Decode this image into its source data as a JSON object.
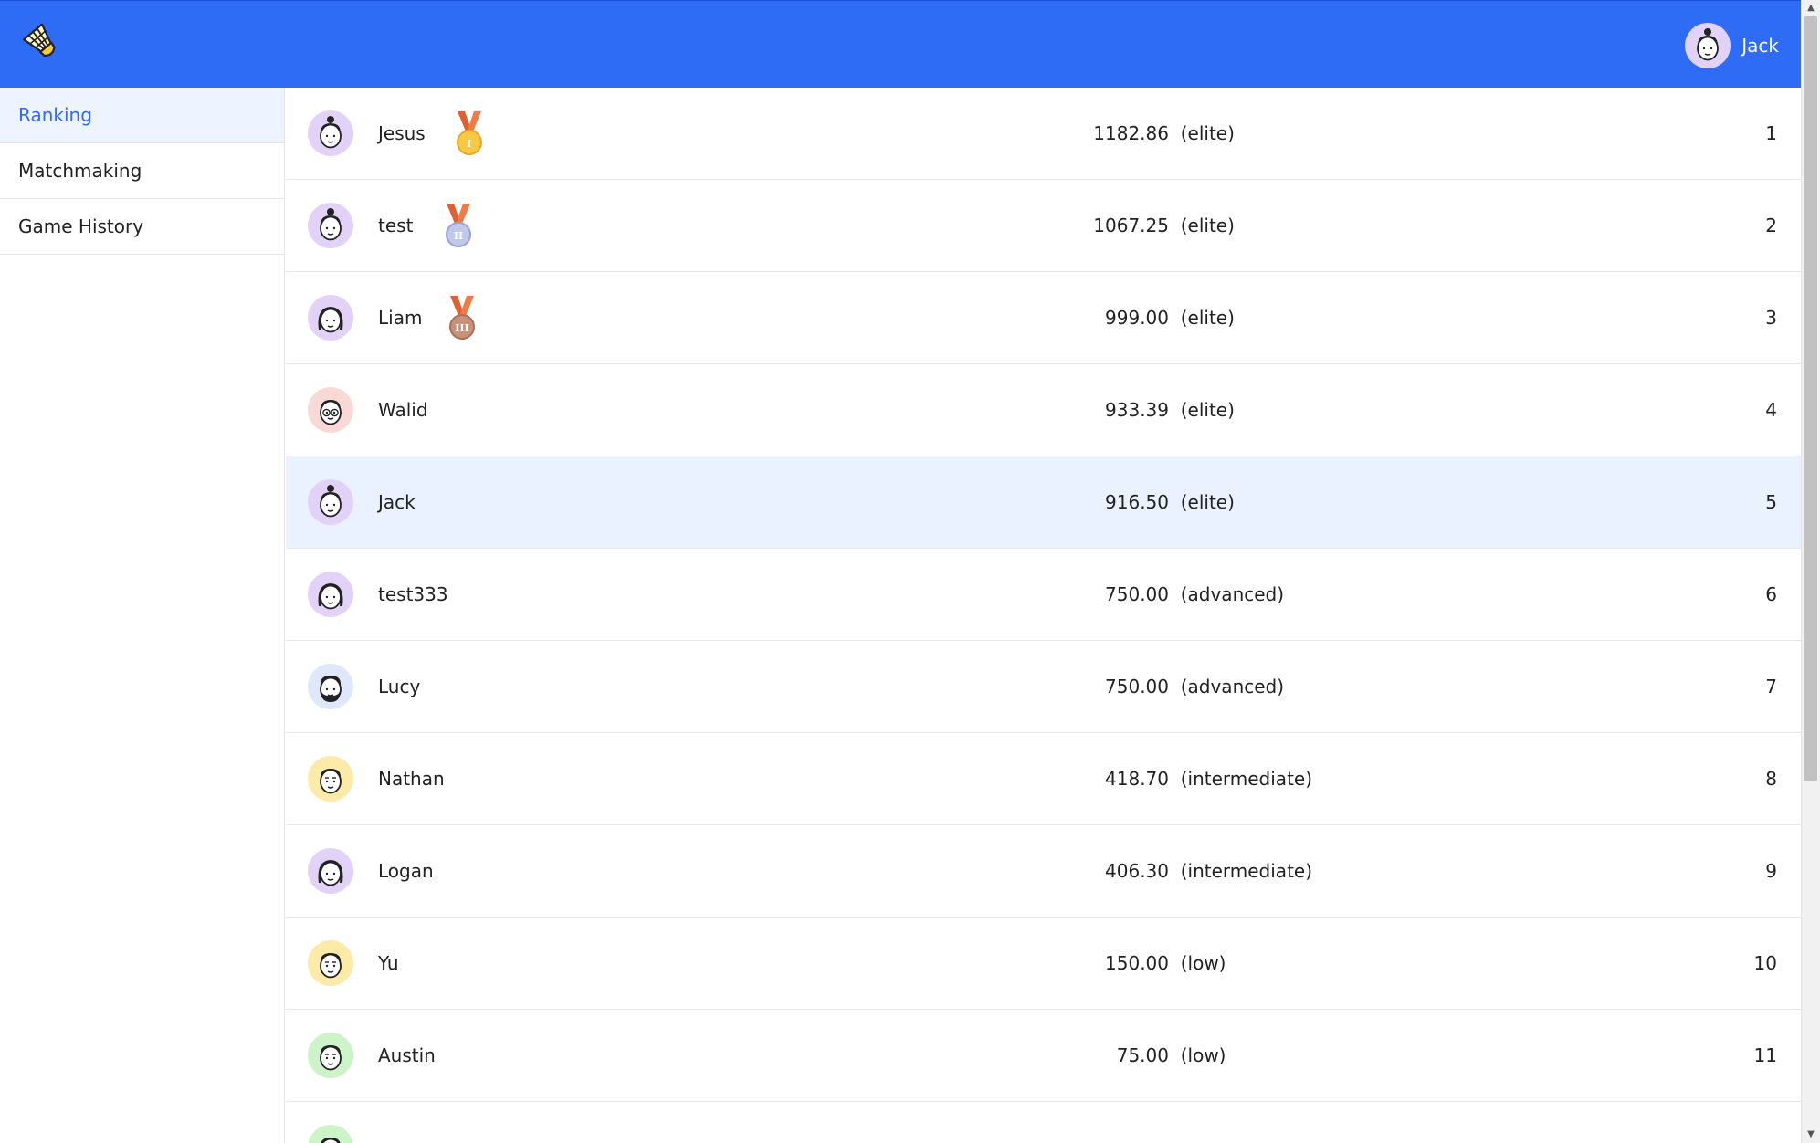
{
  "header": {
    "logo_icon": "shuttlecock-icon",
    "user": {
      "name": "Jack",
      "avatar_icon": "avatar-bun-icon",
      "avatar_bg": "#e3d2f7"
    }
  },
  "sidebar": {
    "items": [
      {
        "label": "Ranking",
        "active": true
      },
      {
        "label": "Matchmaking",
        "active": false
      },
      {
        "label": "Game History",
        "active": false
      }
    ]
  },
  "ranking": {
    "rows": [
      {
        "name": "Jesus",
        "score": "1182.86",
        "level": "(elite)",
        "rank": "1",
        "medal": "gold-medal-icon",
        "avatar_bg": "#e3d2f7",
        "avatar_icon": "avatar-bun-icon"
      },
      {
        "name": "test",
        "score": "1067.25",
        "level": "(elite)",
        "rank": "2",
        "medal": "silver-medal-icon",
        "avatar_bg": "#e3d2f7",
        "avatar_icon": "avatar-bun-icon"
      },
      {
        "name": "Liam",
        "score": "999.00",
        "level": "(elite)",
        "rank": "3",
        "medal": "bronze-medal-icon",
        "avatar_bg": "#e3d2f7",
        "avatar_icon": "avatar-long-hair-icon"
      },
      {
        "name": "Walid",
        "score": "933.39",
        "level": "(elite)",
        "rank": "4",
        "medal": "",
        "avatar_bg": "#f9d9d6",
        "avatar_icon": "avatar-glasses-icon"
      },
      {
        "name": "Jack",
        "score": "916.50",
        "level": "(elite)",
        "rank": "5",
        "medal": "",
        "avatar_bg": "#e3d2f7",
        "avatar_icon": "avatar-bun-icon",
        "highlight": true
      },
      {
        "name": "test333",
        "score": "750.00",
        "level": "(advanced)",
        "rank": "6",
        "medal": "",
        "avatar_bg": "#e3d2f7",
        "avatar_icon": "avatar-long-hair-icon"
      },
      {
        "name": "Lucy",
        "score": "750.00",
        "level": "(advanced)",
        "rank": "7",
        "medal": "",
        "avatar_bg": "#dfe8fb",
        "avatar_icon": "avatar-beard-icon"
      },
      {
        "name": "Nathan",
        "score": "418.70",
        "level": "(intermediate)",
        "rank": "8",
        "medal": "",
        "avatar_bg": "#fbeaa8",
        "avatar_icon": "avatar-short-hair-icon"
      },
      {
        "name": "Logan",
        "score": "406.30",
        "level": "(intermediate)",
        "rank": "9",
        "medal": "",
        "avatar_bg": "#e3d2f7",
        "avatar_icon": "avatar-long-hair-icon"
      },
      {
        "name": "Yu",
        "score": "150.00",
        "level": "(low)",
        "rank": "10",
        "medal": "",
        "avatar_bg": "#fbeaa8",
        "avatar_icon": "avatar-short-hair-icon"
      },
      {
        "name": "Austin",
        "score": "75.00",
        "level": "(low)",
        "rank": "11",
        "medal": "",
        "avatar_bg": "#cdf3c8",
        "avatar_icon": "avatar-short-hair-icon"
      },
      {
        "name": "",
        "score": "",
        "level": "",
        "rank": "",
        "medal": "",
        "avatar_bg": "#cdf3c8",
        "avatar_icon": "avatar-short-hair-icon",
        "partial": true
      }
    ]
  },
  "colors": {
    "accent": "#2f6cf6",
    "highlight_row": "#eaf1ff"
  }
}
